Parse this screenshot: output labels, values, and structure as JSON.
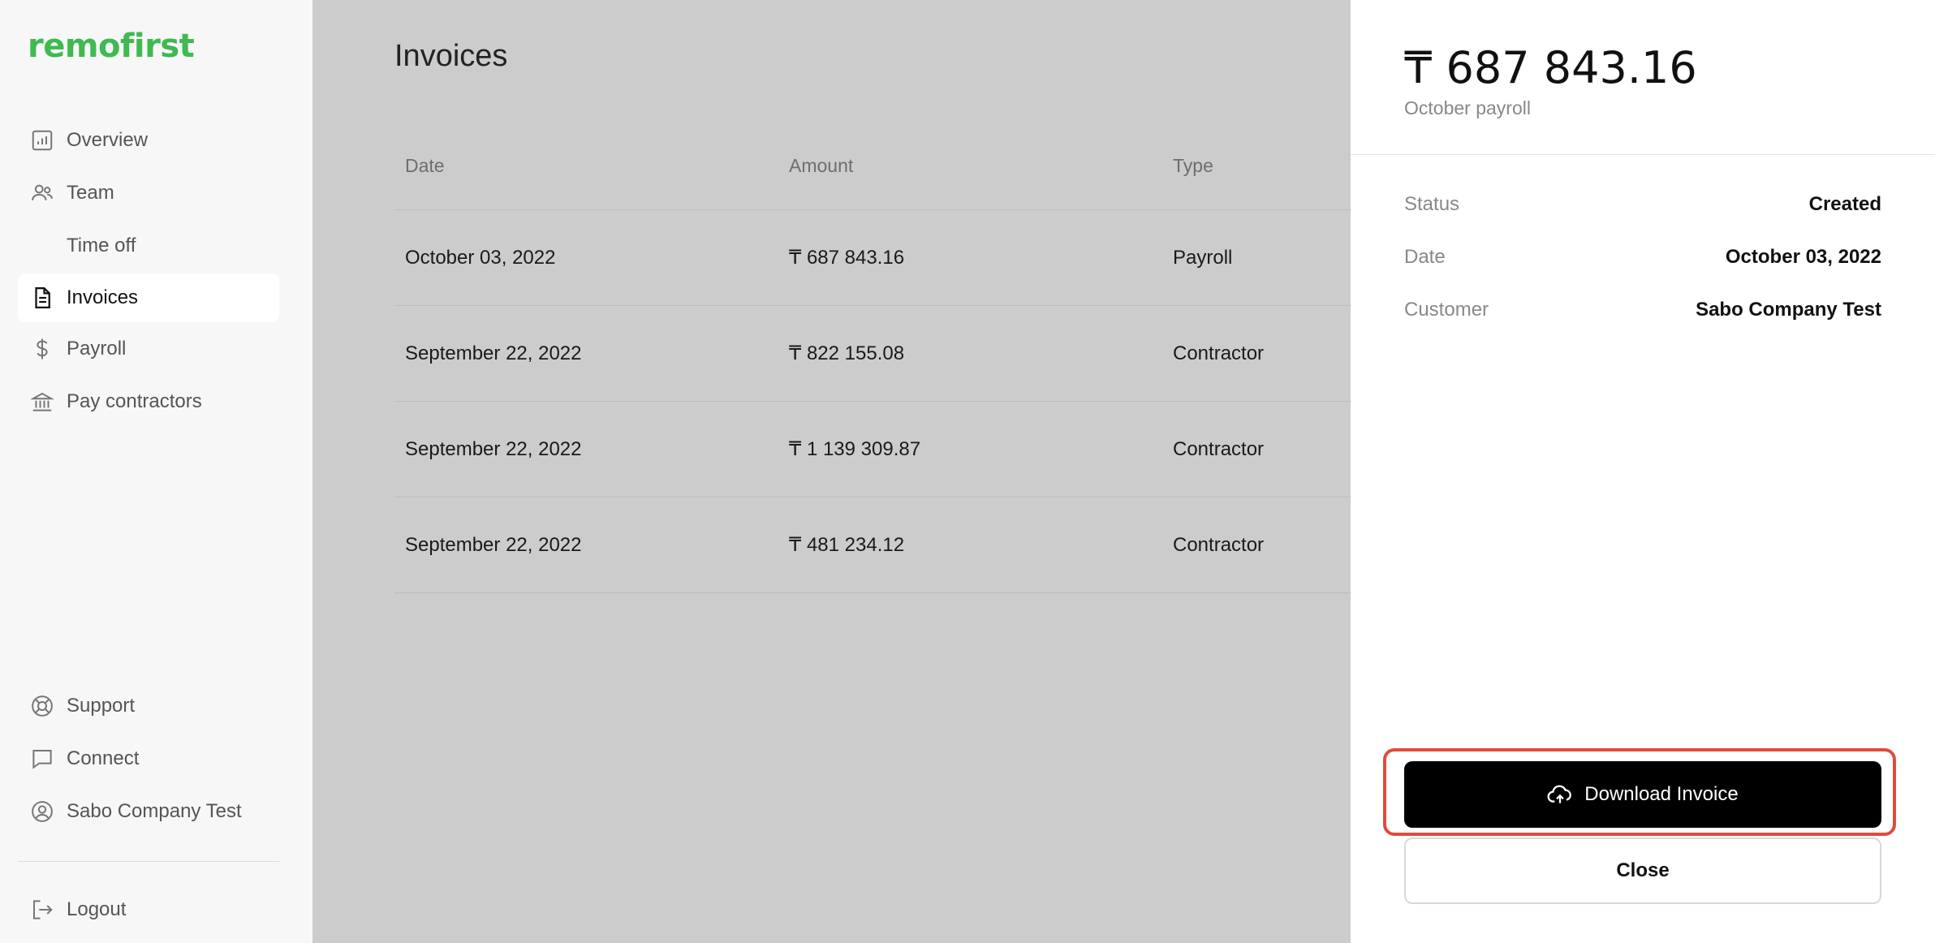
{
  "brand": {
    "logo_text": "remofirst",
    "color": "#3fb950"
  },
  "sidebar": {
    "items": [
      {
        "label": "Overview",
        "icon": "chart-icon"
      },
      {
        "label": "Team",
        "icon": "people-icon"
      },
      {
        "label": "Time off",
        "icon": ""
      },
      {
        "label": "Invoices",
        "icon": "document-icon",
        "active": true
      },
      {
        "label": "Payroll",
        "icon": "dollar-icon"
      },
      {
        "label": "Pay contractors",
        "icon": "bank-icon"
      }
    ],
    "bottom_items": [
      {
        "label": "Support",
        "icon": "lifebuoy-icon"
      },
      {
        "label": "Connect",
        "icon": "chat-icon"
      },
      {
        "label": "Sabo Company Test",
        "icon": "user-circle-icon"
      }
    ],
    "logout": {
      "label": "Logout",
      "icon": "logout-icon"
    }
  },
  "main": {
    "title": "Invoices",
    "columns": [
      "Date",
      "Amount",
      "Type"
    ],
    "rows": [
      {
        "date": "October 03, 2022",
        "amount": "₸ 687 843.16",
        "type": "Payroll"
      },
      {
        "date": "September 22, 2022",
        "amount": "₸ 822 155.08",
        "type": "Contractor"
      },
      {
        "date": "September 22, 2022",
        "amount": "₸ 1 139 309.87",
        "type": "Contractor"
      },
      {
        "date": "September 22, 2022",
        "amount": "₸ 481 234.12",
        "type": "Contractor"
      }
    ]
  },
  "drawer": {
    "amount": "₸ 687 843.16",
    "subtitle": "October payroll",
    "details": [
      {
        "key": "Status",
        "value": "Created"
      },
      {
        "key": "Date",
        "value": "October 03, 2022"
      },
      {
        "key": "Customer",
        "value": "Sabo Company Test"
      }
    ],
    "download_label": "Download Invoice",
    "close_label": "Close",
    "highlight_color": "#e14b3b"
  }
}
